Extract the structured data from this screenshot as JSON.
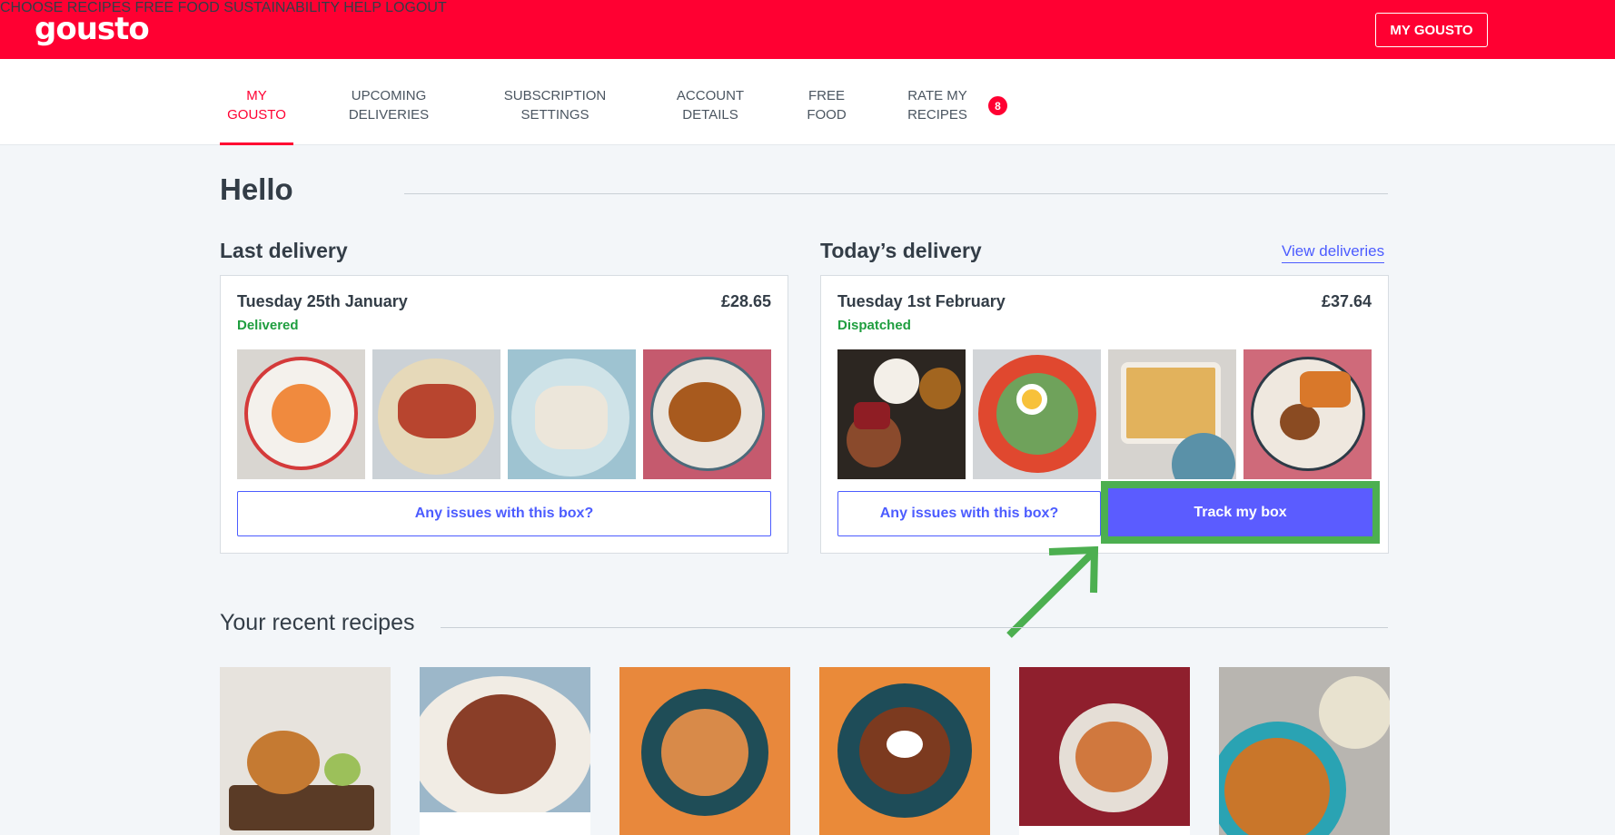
{
  "header": {
    "logo": "gousto",
    "nav": [
      "CHOOSE RECIPES",
      "FREE FOOD",
      "SUSTAINABILITY",
      "HELP"
    ],
    "my_gousto": "MY GOUSTO",
    "logout": "LOGOUT"
  },
  "subnav": {
    "tabs": [
      {
        "line1": "MY",
        "line2": "GOUSTO"
      },
      {
        "line1": "UPCOMING",
        "line2": "DELIVERIES"
      },
      {
        "line1": "SUBSCRIPTION",
        "line2": "SETTINGS"
      },
      {
        "line1": "ACCOUNT",
        "line2": "DETAILS"
      },
      {
        "line1": "FREE",
        "line2": "FOOD"
      },
      {
        "line1": "RATE MY",
        "line2": "RECIPES"
      }
    ],
    "rate_badge": "8"
  },
  "page": {
    "greeting": "Hello",
    "last_title": "Last delivery",
    "today_title": "Today’s delivery",
    "view_deliveries": "View deliveries",
    "recent_title": "Your recent recipes"
  },
  "last_delivery": {
    "date": "Tuesday 25th January",
    "price": "£28.65",
    "status": "Delivered",
    "issues_label": "Any issues with this box?"
  },
  "today_delivery": {
    "date": "Tuesday 1st February",
    "price": "£37.64",
    "status": "Dispatched",
    "issues_label": "Any issues with this box?",
    "track_label": "Track my box"
  },
  "colors": {
    "brand_red": "#ff0032",
    "action_blue": "#5b5cff",
    "status_green": "#1f9e3f",
    "highlight_green": "#4caf50"
  }
}
